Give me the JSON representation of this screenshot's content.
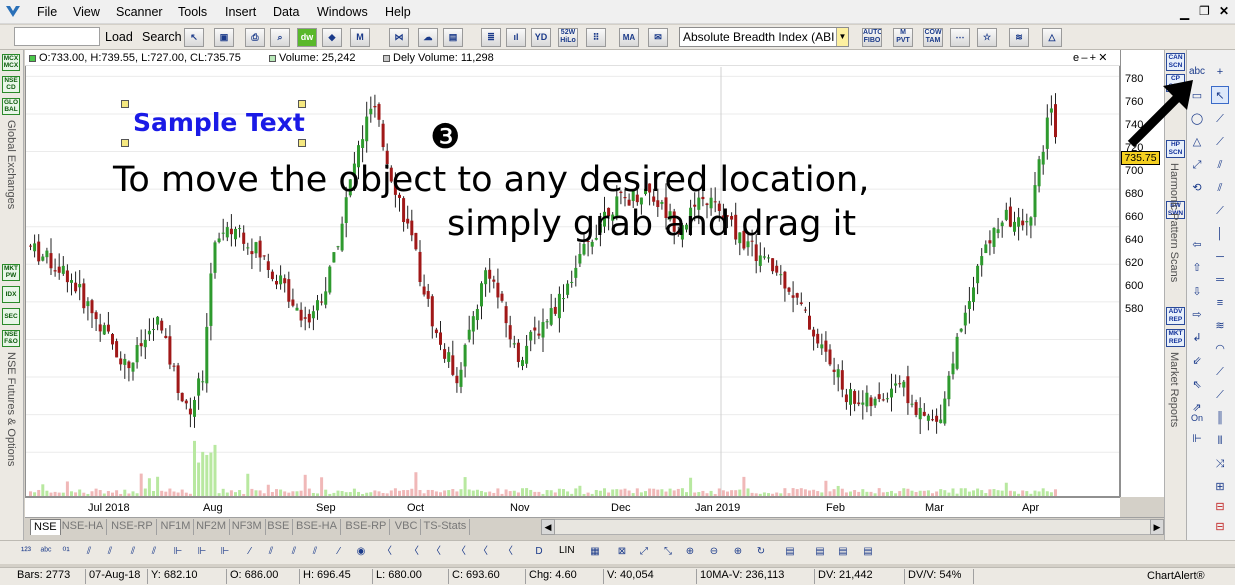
{
  "menu": [
    "File",
    "View",
    "Scanner",
    "Tools",
    "Insert",
    "Data",
    "Windows",
    "Help"
  ],
  "toolbar": {
    "load_label": "Load",
    "search_label": "Search",
    "search_value": "",
    "indicator_select": "Absolute Breadth Index (ABI",
    "icons": {
      "w52": "52W\nHiLo",
      "auto_fibo": "AUTO\nFIBO",
      "m_pvt": "M\nPVT",
      "cow_tam": "COW\nTAM",
      "ma": "MA"
    }
  },
  "info": {
    "ohlc": "O:733.00, H:739.55, L:727.00, CL:735.75",
    "volume": "Volume: 25,242",
    "dely_volume": "Dely Volume: 11,298",
    "controls": "e – + ✕"
  },
  "annotation": {
    "sample_text": "Sample Text",
    "step_marker": "❸",
    "line1": "To move the object to any desired location,",
    "line2": "simply grab and drag it"
  },
  "left_strip": {
    "group1": [
      "MCX\nMCX",
      "NSE\nCD",
      "GLO\nBAL"
    ],
    "group1_label": "Global Exchanges",
    "group2": [
      "MKT\nPW",
      "IDX",
      "SEC",
      "NSE\nF&O"
    ],
    "group2_label": "NSE Futures & Options"
  },
  "right_strip": {
    "group1": [
      "CAN\nSCN",
      "CP\nSCN",
      "HP\nSCN",
      "EW\nSWN"
    ],
    "group1_label": "Harmonic Pattern Scans",
    "group2": [
      "ADV\nREP",
      "MKT\nREP"
    ],
    "group2_label": "Market Reports"
  },
  "draw_tools": {
    "text_tool": "abc",
    "on_label": "On"
  },
  "y_axis": {
    "ticks": [
      "780",
      "760",
      "740",
      "720",
      "700",
      "680",
      "660",
      "640",
      "620",
      "600",
      "580"
    ],
    "last_price": "735.75",
    "price_color": "#f5d020"
  },
  "x_axis": {
    "labels": [
      "Jul 2018",
      "Aug",
      "Sep",
      "Oct",
      "Nov",
      "Dec",
      "Jan 2019",
      "Feb",
      "Mar",
      "Apr"
    ]
  },
  "tabs": [
    "NSE",
    "NSE-HA",
    "NSE-RP",
    "NF1M",
    "NF2M",
    "NF3M",
    "BSE",
    "BSE-HA",
    "BSE-RP",
    "VBC",
    "TS-Stats"
  ],
  "active_tab": "NSE",
  "bottom_toolbar": {
    "lin": "LIN"
  },
  "status": {
    "bars": "Bars: 2773",
    "date": "07-Aug-18",
    "y": "Y: 682.10",
    "o": "O: 686.00",
    "h": "H: 696.45",
    "l": "L: 680.00",
    "c": "C: 693.60",
    "chg": "Chg: 4.60",
    "v": "V: 40,054",
    "ma": "10MA-V: 236,113",
    "dv": "DV: 21,442",
    "dvv": "DV/V: 54%",
    "app": "ChartAlert®"
  },
  "colors": {
    "up": "#2e9a2e",
    "down": "#a01818",
    "vol_up": "#b8e8a0",
    "vol_down": "#f0b8b8",
    "sample_text": "#1a1ae6"
  }
}
